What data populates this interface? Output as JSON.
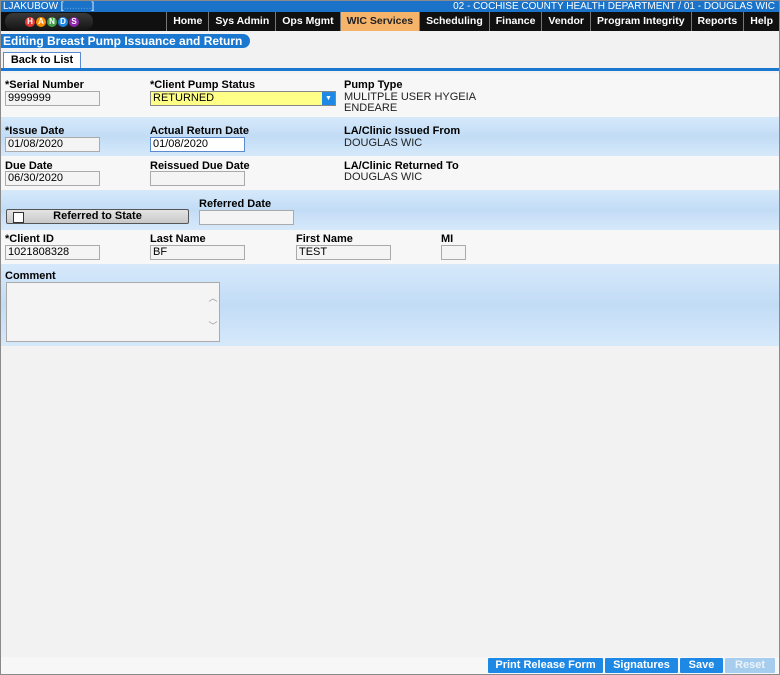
{
  "header": {
    "username": "LJAKUBOW [",
    "username_hidden": "..........",
    "username_close": "]",
    "department": "02 - COCHISE COUNTY HEALTH DEPARTMENT / 01 - DOUGLAS WIC",
    "logo_letters": [
      "H",
      "A",
      "N",
      "D",
      "S"
    ]
  },
  "nav": {
    "items": [
      {
        "label": "Home"
      },
      {
        "label": "Sys Admin"
      },
      {
        "label": "Ops Mgmt"
      },
      {
        "label": "WIC Services",
        "active": true
      },
      {
        "label": "Scheduling"
      },
      {
        "label": "Finance"
      },
      {
        "label": "Vendor"
      },
      {
        "label": "Program Integrity"
      },
      {
        "label": "Reports"
      },
      {
        "label": "Help"
      }
    ],
    "active_color": "#f6b36a"
  },
  "page": {
    "title": "Editing Breast Pump Issuance and Return",
    "back_button": "Back to List"
  },
  "form": {
    "serial_number": {
      "label": "*Serial Number",
      "value": "9999999"
    },
    "client_pump_status": {
      "label": "*Client Pump Status",
      "value": "RETURNED"
    },
    "pump_type": {
      "label": "Pump Type",
      "value_line1": "MULITPLE USER HYGEIA",
      "value_line2": "ENDEARE"
    },
    "issue_date": {
      "label": "*Issue Date",
      "value": "01/08/2020"
    },
    "actual_return_date": {
      "label": "Actual Return Date",
      "value": "01/08/2020"
    },
    "clinic_issued_from": {
      "label": "LA/Clinic Issued From",
      "value": "DOUGLAS WIC"
    },
    "due_date": {
      "label": "Due Date",
      "value": "06/30/2020"
    },
    "reissued_due_date": {
      "label": "Reissued Due Date",
      "value": ""
    },
    "clinic_returned_to": {
      "label": "LA/Clinic Returned To",
      "value": "DOUGLAS WIC"
    },
    "referred_to_state": {
      "label": "Referred to State",
      "checked": false
    },
    "referred_date": {
      "label": "Referred Date",
      "value": ""
    },
    "client_id": {
      "label": "*Client ID",
      "value": "1021808328"
    },
    "last_name": {
      "label": "Last Name",
      "value": "BF"
    },
    "first_name": {
      "label": "First Name",
      "value": "TEST"
    },
    "mi": {
      "label": "MI",
      "value": ""
    },
    "comment": {
      "label": "Comment",
      "value": ""
    }
  },
  "footer": {
    "print_release_form": "Print Release Form",
    "signatures": "Signatures",
    "save": "Save",
    "reset": "Reset"
  },
  "colors": {
    "brand_blue": "#1a78d0",
    "button_blue": "#1e88e5",
    "status_highlight": "#ffff88"
  }
}
